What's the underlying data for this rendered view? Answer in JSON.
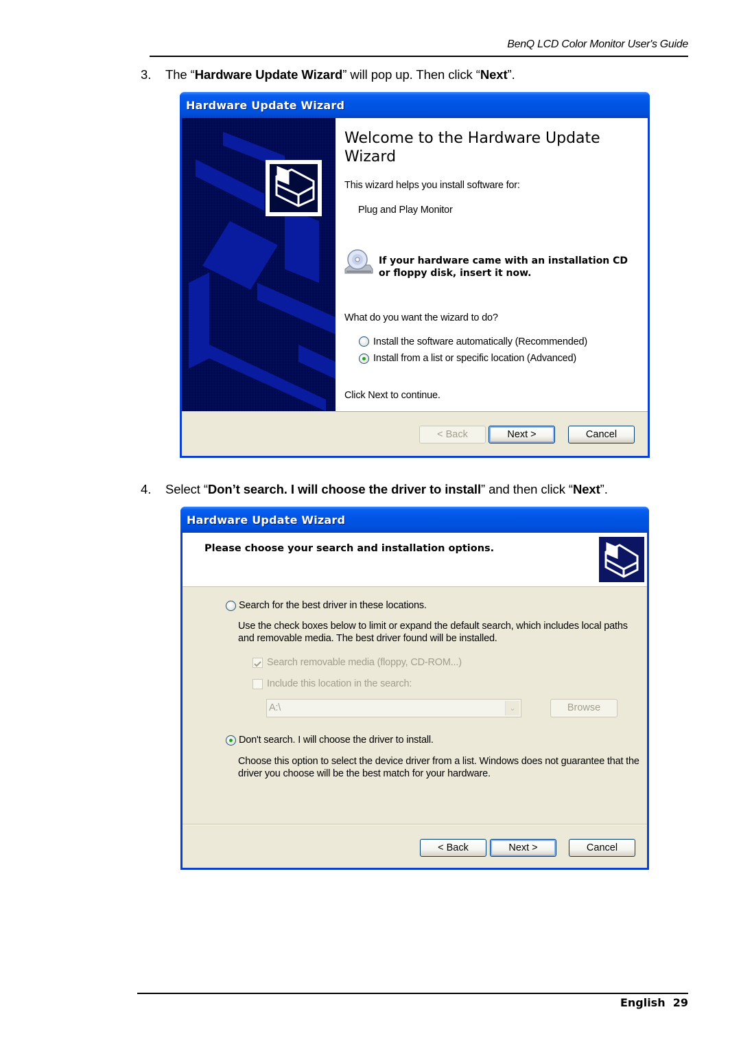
{
  "header": {
    "guide_title": "BenQ LCD Color Monitor User's Guide"
  },
  "steps": [
    {
      "number": "3.",
      "parts": [
        {
          "text": "The “",
          "bold": false
        },
        {
          "text": "Hardware Update Wizard",
          "bold": true
        },
        {
          "text": "” will pop up. Then click “",
          "bold": false
        },
        {
          "text": "Next",
          "bold": true
        },
        {
          "text": "”.",
          "bold": false
        }
      ]
    },
    {
      "number": "4.",
      "parts": [
        {
          "text": "Select “",
          "bold": false
        },
        {
          "text": "Don’t search. I will choose the driver to install",
          "bold": true
        },
        {
          "text": "” and then click “",
          "bold": false
        },
        {
          "text": "Next",
          "bold": true
        },
        {
          "text": "”.",
          "bold": false
        }
      ]
    }
  ],
  "dialog1": {
    "title": "Hardware Update Wizard",
    "heading": "Welcome to the Hardware Update Wizard",
    "intro": "This wizard helps you install software for:",
    "device": "Plug and Play Monitor",
    "cd_note": "If your hardware came with an installation CD or floppy disk, insert it now.",
    "question": "What do you want the wizard to do?",
    "options": [
      {
        "label": "Install the software automatically (Recommended)",
        "checked": false
      },
      {
        "label": "Install from a list or specific location (Advanced)",
        "checked": true
      }
    ],
    "continue_text": "Click Next to continue.",
    "buttons": {
      "back": "< Back",
      "next": "Next >",
      "cancel": "Cancel"
    },
    "icons": {
      "sidebar": "hardware-wizard-icon",
      "cd": "cd-drive-icon"
    },
    "colors": {
      "title_bar": "#0055e5",
      "sidebar": "#000a52"
    }
  },
  "dialog2": {
    "title": "Hardware Update Wizard",
    "heading": "Please choose your search and installation options.",
    "option_search": {
      "label": "Search for the best driver in these locations.",
      "checked": false
    },
    "search_desc": "Use the check boxes below to limit or expand the default search, which includes local paths and removable media. The best driver found will be installed.",
    "checkboxes": [
      {
        "label": "Search removable media (floppy, CD-ROM...)",
        "checked": true,
        "disabled": true
      },
      {
        "label": "Include this location in the search:",
        "checked": false,
        "disabled": true
      }
    ],
    "location_value": "A:\\",
    "browse_label": "Browse",
    "option_dont_search": {
      "label": "Don't search. I will choose the driver to install.",
      "checked": true
    },
    "dont_search_desc": "Choose this option to select the device driver from a list.  Windows does not guarantee that the driver you choose will be the best match for your hardware.",
    "buttons": {
      "back": "< Back",
      "next": "Next >",
      "cancel": "Cancel"
    },
    "icons": {
      "header": "hardware-wizard-icon"
    }
  },
  "footer": {
    "language": "English",
    "page_number": "29"
  }
}
